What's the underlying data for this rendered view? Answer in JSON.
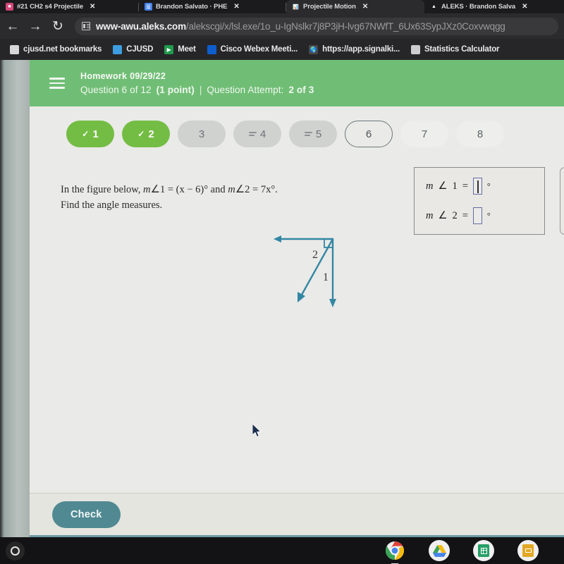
{
  "browser": {
    "tabs": [
      {
        "title": "#21 CH2 s4 Projectile",
        "favicon": "pdf-icon",
        "active": false
      },
      {
        "title": "Brandon Salvato · PHE",
        "favicon": "docs-icon",
        "active": false
      },
      {
        "title": "Projectile Motion",
        "favicon": "chart-icon",
        "active": true
      },
      {
        "title": "ALEKS · Brandon Salva",
        "favicon": "aleks-icon",
        "active": false
      }
    ],
    "close_label": "✕",
    "nav": {
      "back": "←",
      "forward": "→",
      "reload": "↻"
    },
    "omnibox": {
      "host": "www-awu.aleks.com",
      "path": "/alekscgi/x/lsl.exe/1o_u-IgNslkr7j8P3jH-lvg67NWfT_6Ux63SypJXz0Coxvwqgg",
      "site_icon": "site-info-icon"
    },
    "bookmarks": [
      {
        "label": "cjusd.net bookmarks",
        "icon": "folder-icon"
      },
      {
        "label": "CJUSD",
        "icon": "droplet-icon"
      },
      {
        "label": "Meet",
        "icon": "meet-icon"
      },
      {
        "label": "Cisco Webex Meeti...",
        "icon": "webex-icon"
      },
      {
        "label": "https://app.signalki...",
        "icon": "globe-icon"
      },
      {
        "label": "Statistics Calculator",
        "icon": "calculator-icon"
      }
    ]
  },
  "aleks": {
    "header": {
      "menu_icon": "hamburger-menu-icon",
      "assignment": "Homework 09/29/22",
      "question_counter_prefix": "Question 6 of 12",
      "points": "(1 point)",
      "divider": "|",
      "attempt_label": "Question Attempt:",
      "attempt_value": "2 of 3"
    },
    "pills": [
      {
        "number": "1",
        "state": "done",
        "mark": "✓"
      },
      {
        "number": "2",
        "state": "done",
        "mark": "✓"
      },
      {
        "number": "3",
        "state": "gray",
        "mark": ""
      },
      {
        "number": "4",
        "state": "gray",
        "mark": "lines-icon"
      },
      {
        "number": "5",
        "state": "gray",
        "mark": "lines-icon"
      },
      {
        "number": "6",
        "state": "current",
        "mark": ""
      },
      {
        "number": "7",
        "state": "light",
        "mark": ""
      },
      {
        "number": "8",
        "state": "light",
        "mark": ""
      }
    ],
    "question": {
      "line1_a": "In the figure below,",
      "line1_m1": "m",
      "line1_angle1": "∠",
      "line1_eq1": "1 = (x − 6)°",
      "line1_and": "and",
      "line1_m2": "m",
      "line1_angle2": "∠",
      "line1_eq2": "2 = 7x°.",
      "line2": "Find the angle measures."
    },
    "figure": {
      "label_angle2": "2",
      "label_angle1": "1",
      "stroke_color": "#2f89a8",
      "right_angle_marker": "right-angle-square"
    },
    "answers": [
      {
        "m": "m",
        "angle": "∠",
        "num": "1",
        "eq": "=",
        "value": "",
        "degree": "°",
        "focused": true
      },
      {
        "m": "m",
        "angle": "∠",
        "num": "2",
        "eq": "=",
        "value": "",
        "degree": "°",
        "focused": false
      }
    ],
    "check_button": "Check"
  },
  "shelf": {
    "launcher": "launcher-button",
    "apps": [
      {
        "name": "chrome-icon"
      },
      {
        "name": "google-drive-icon"
      },
      {
        "name": "google-sheets-icon"
      },
      {
        "name": "google-slides-icon"
      }
    ]
  },
  "colors": {
    "aleks_green": "#6ec173",
    "pill_done": "#72c040",
    "check_teal": "#4e8b94",
    "figure_blue": "#2f89a8",
    "input_border": "#5f6fa8"
  }
}
